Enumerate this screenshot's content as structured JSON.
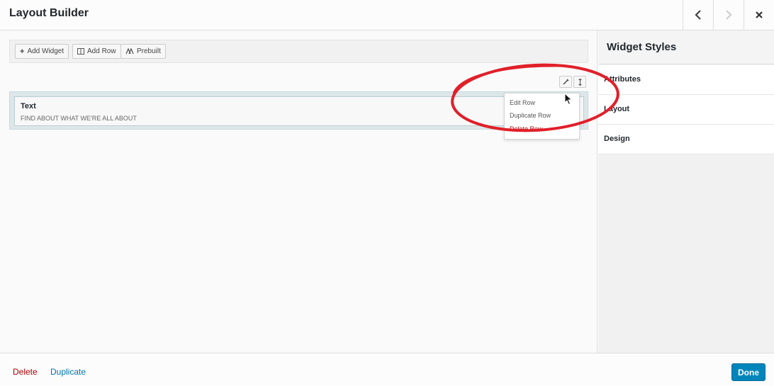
{
  "window": {
    "title": "Layout Builder",
    "prev_icon": "chevron-left-icon",
    "next_icon": "chevron-right-icon",
    "close_icon": "close-icon"
  },
  "toolbar": {
    "add_widget": "Add Widget",
    "add_row": "Add Row",
    "prebuilt": "Prebuilt"
  },
  "row": {
    "widget": {
      "title": "Text",
      "description": "FIND ABOUT WHAT WE'RE ALL ABOUT"
    },
    "menu": {
      "items": [
        "Edit Row",
        "Duplicate Row",
        "Delete Row"
      ]
    }
  },
  "sidebar": {
    "title": "Widget Styles",
    "sections": [
      "Attributes",
      "Layout",
      "Design"
    ]
  },
  "footer": {
    "delete": "Delete",
    "duplicate": "Duplicate",
    "done": "Done"
  },
  "colors": {
    "primary": "#0085ba",
    "danger": "#aa0000",
    "link": "#0073aa",
    "annotation": "#e0202a"
  }
}
